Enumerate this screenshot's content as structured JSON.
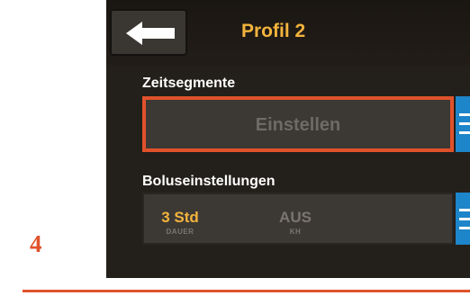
{
  "header": {
    "back_icon": "arrow-left-icon",
    "title": "Profil 2"
  },
  "segments": {
    "label": "Zeitsegmente",
    "button_label": "Einstellen",
    "menu_icon": "hamburger-menu-icon"
  },
  "bolus": {
    "label": "Boluseinstellungen",
    "duration_value": "3 Std",
    "duration_caption": "DAUER",
    "carb_value": "AUS",
    "carb_caption": "KH",
    "menu_icon": "hamburger-menu-icon"
  },
  "annotation": {
    "step_number": "4"
  },
  "colors": {
    "accent_orange": "#e0522b",
    "title_amber": "#f3b43d",
    "menu_blue": "#1d85c9",
    "screen_bg": "#231f1a"
  }
}
